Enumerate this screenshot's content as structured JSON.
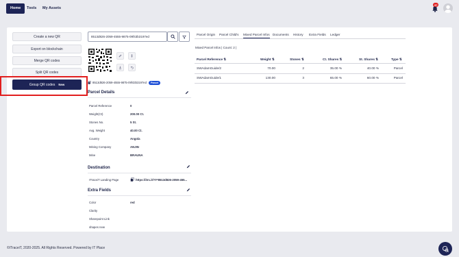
{
  "nav": {
    "home": "Home",
    "tools": "Tools",
    "my_assets": "My Assets"
  },
  "notifications": {
    "count": "37"
  },
  "left_actions": {
    "create_qr": "Create a new QR",
    "export_blockchain": "Export on blockchain",
    "merge_qr": "Merge QR codes",
    "split_qr": "Split QR codes",
    "group_qr": "Group QR codes",
    "group_new": "New"
  },
  "search": {
    "value": "8513d826-2059-4555-9875-09f43b3197ed"
  },
  "qr_panel": {
    "uuid": "8513d826-2059-4555-9875-09f43b3197ed",
    "pill": "Parcel"
  },
  "parcel_details": {
    "title": "Parcel Details",
    "rows": [
      {
        "k": "Parcel Reference",
        "v": "0"
      },
      {
        "k": "Weight(Ct)",
        "v": "200.00 Ct."
      },
      {
        "k": "Stones No.",
        "v": "5 St."
      },
      {
        "k": "Avg. Weight",
        "v": "40.00 Ct."
      },
      {
        "k": "Country",
        "v": "Angola"
      },
      {
        "k": "Mining Company",
        "v": "ANJIN"
      },
      {
        "k": "Mine",
        "v": "BRAUNA"
      }
    ]
  },
  "destination": {
    "title": "Destination",
    "label": "ITraceiT Landing Page",
    "link": "https://itrc.it/?t=8513d826-2059-455..."
  },
  "extra_fields": {
    "title": "Extra Fields",
    "rows": [
      {
        "k": "Color",
        "v": "red"
      },
      {
        "k": "Clarity",
        "v": ""
      },
      {
        "k": "Sharepoint Link",
        "v": ""
      },
      {
        "k": "shapes new",
        "v": ""
      }
    ]
  },
  "tabs": [
    "Parcel Origin",
    "Parcel Child's",
    "Mixed Parcel Infos",
    "Documents",
    "History",
    "Extra Fields",
    "Ledger"
  ],
  "mixed_info": {
    "title": "Mixed Parcel Infos | Count: 2 |"
  },
  "table": {
    "headers": {
      "ref": "Parcel Reference",
      "weight": "Weight",
      "stones": "Stones",
      "ct_shares": "Ct. Shares",
      "st_shares": "St. Shares",
      "type": "Type"
    },
    "rows": [
      {
        "ref": "SWAdamGuide/2",
        "weight": "70.00",
        "stones": "2",
        "ct_shares": "35.00 %",
        "st_shares": "40.00 %",
        "type": "Parcel"
      },
      {
        "ref": "SWAdamGuide/1",
        "weight": "130.00",
        "stones": "3",
        "ct_shares": "65.00 %",
        "st_shares": "60.00 %",
        "type": "Parcel"
      }
    ]
  },
  "footer": {
    "text": "©ITraceiT, 2020-2025. All Rights Reserved. Powered by",
    "brand": "IT Place"
  },
  "colors": {
    "primary": "#1d2456",
    "highlight": "#e11d1d",
    "pill": "#1d4fd6",
    "badge": "#e02424"
  }
}
